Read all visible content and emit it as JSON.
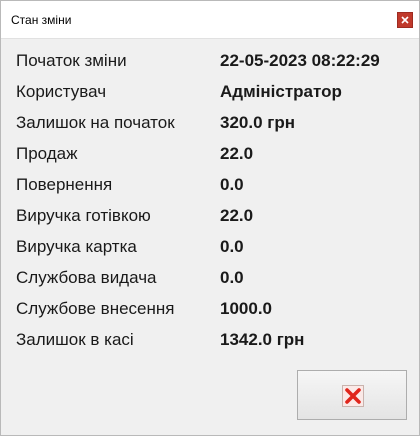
{
  "window": {
    "title": "Стан зміни"
  },
  "rows": [
    {
      "label": "Початок зміни",
      "value": "22-05-2023 08:22:29"
    },
    {
      "label": "Користувач",
      "value": "Адміністратор"
    },
    {
      "label": "Залишок на початок",
      "value": "320.0 грн"
    },
    {
      "label": "Продаж",
      "value": "22.0"
    },
    {
      "label": "Повернення",
      "value": "0.0"
    },
    {
      "label": "Виручка готівкою",
      "value": "22.0"
    },
    {
      "label": "Виручка картка",
      "value": "0.0"
    },
    {
      "label": "Службова видача",
      "value": "0.0"
    },
    {
      "label": "Службове внесення",
      "value": "1000.0"
    },
    {
      "label": "Залишок в касі",
      "value": "1342.0 грн"
    }
  ],
  "icons": {
    "close": "close-icon",
    "cancel": "cancel-x-icon"
  },
  "colors": {
    "close_button": "#c0392b",
    "cancel_icon": "#e0251b"
  }
}
